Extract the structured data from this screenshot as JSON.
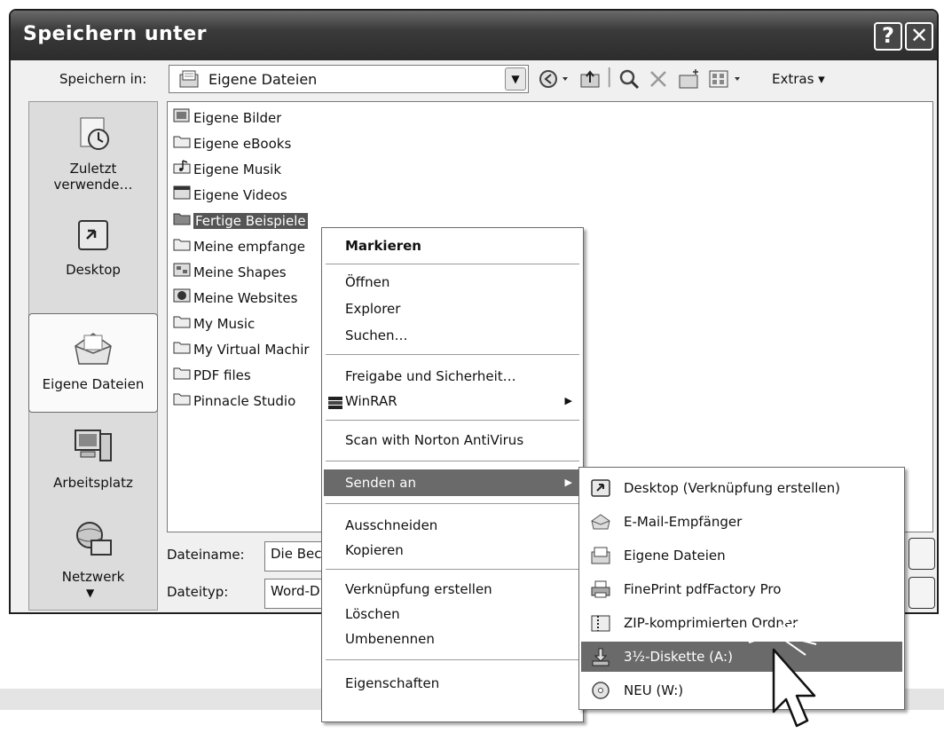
{
  "dialog": {
    "title": "Speichern unter",
    "help_label": "?",
    "close_label": "✕",
    "save_in_label": "Speichern in:",
    "save_in_value": "Eigene Dateien",
    "extras_label": "Extras ▾",
    "filename_label": "Dateiname:",
    "filename_value": "Die Bec",
    "filetype_label": "Dateityp:",
    "filetype_value": "Word-D"
  },
  "places": [
    {
      "label": "Zuletzt verwende…",
      "icon": "recent-icon"
    },
    {
      "label": "Desktop",
      "icon": "desktop-icon"
    },
    {
      "label": "Eigene Dateien",
      "icon": "my-documents-icon"
    },
    {
      "label": "Arbeitsplatz",
      "icon": "my-computer-icon"
    },
    {
      "label": "Netzwerk",
      "icon": "network-icon"
    }
  ],
  "files": [
    {
      "name": "Eigene Bilder",
      "icon": "pictures-folder-icon"
    },
    {
      "name": "Eigene eBooks",
      "icon": "folder-icon"
    },
    {
      "name": "Eigene Musik",
      "icon": "music-folder-icon"
    },
    {
      "name": "Eigene Videos",
      "icon": "video-folder-icon"
    },
    {
      "name": "Fertige Beispiele",
      "icon": "folder-icon"
    },
    {
      "name": "Meine empfange",
      "icon": "folder-icon"
    },
    {
      "name": "Meine Shapes",
      "icon": "shapes-folder-icon"
    },
    {
      "name": "Meine Websites",
      "icon": "websites-folder-icon"
    },
    {
      "name": "My Music",
      "icon": "folder-icon"
    },
    {
      "name": "My Virtual Machir",
      "icon": "folder-icon"
    },
    {
      "name": "PDF files",
      "icon": "folder-icon"
    },
    {
      "name": "Pinnacle Studio",
      "icon": "folder-icon"
    }
  ],
  "context_menu": {
    "items": [
      "Markieren",
      "Öffnen",
      "Explorer",
      "Suchen…",
      "Freigabe und Sicherheit…",
      "WinRAR",
      "Scan with Norton AntiVirus",
      "Senden an",
      "Ausschneiden",
      "Kopieren",
      "Verknüpfung erstellen",
      "Löschen",
      "Umbenennen",
      "Eigenschaften"
    ]
  },
  "send_to_menu": {
    "items": [
      {
        "label": "Desktop (Verknüpfung erstellen)",
        "icon": "desktop-shortcut-icon"
      },
      {
        "label": "E-Mail-Empfänger",
        "icon": "mail-icon"
      },
      {
        "label": "Eigene Dateien",
        "icon": "my-documents-icon"
      },
      {
        "label": "FinePrint pdfFactory Pro",
        "icon": "printer-icon"
      },
      {
        "label": "ZIP-komprimierten Ordner",
        "icon": "zip-folder-icon"
      },
      {
        "label": "3½-Diskette (A:)",
        "icon": "floppy-icon"
      },
      {
        "label": "NEU (W:)",
        "icon": "cd-drive-icon"
      }
    ]
  },
  "colors": {
    "titlebar": "#2c2c2c",
    "highlight": "#6a6a6a",
    "selection": "#555555"
  }
}
